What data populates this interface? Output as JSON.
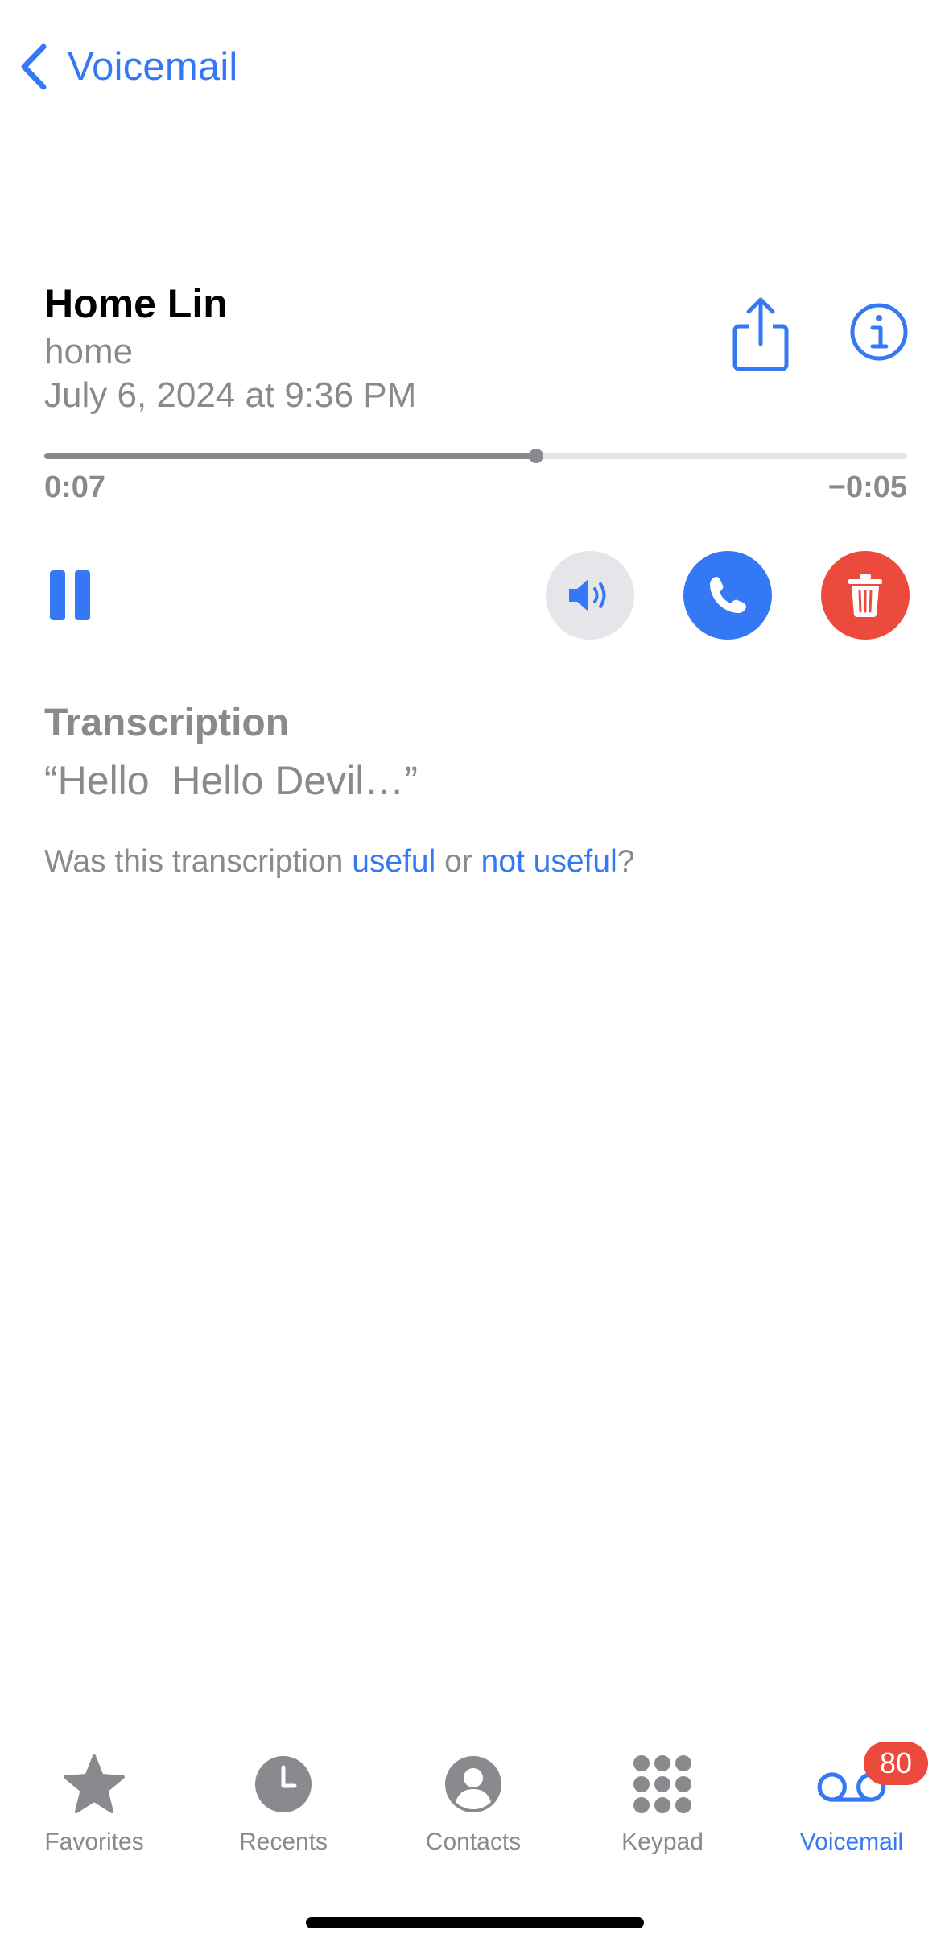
{
  "nav": {
    "back_label": "Voicemail"
  },
  "voicemail": {
    "caller_name": "Home Lin",
    "caller_label": "home",
    "date": "July 6, 2024 at 9:36 PM",
    "elapsed": "0:07",
    "remaining": "−0:05",
    "progress": 0.57
  },
  "transcription": {
    "title": "Transcription",
    "text": "“Hello  Hello Devil…”",
    "feedback_prefix": "Was this transcription ",
    "useful_label": "useful",
    "feedback_middle": " or ",
    "not_useful_label": "not useful",
    "feedback_suffix": "?"
  },
  "icons": {
    "back": "chevron-left-icon",
    "share": "share-icon",
    "info": "info-icon",
    "pause": "pause-icon",
    "speaker": "speaker-icon",
    "call": "phone-icon",
    "delete": "trash-icon"
  },
  "tabs": [
    {
      "label": "Favorites",
      "icon": "star-icon",
      "active": false
    },
    {
      "label": "Recents",
      "icon": "clock-icon",
      "active": false
    },
    {
      "label": "Contacts",
      "icon": "person-icon",
      "active": false
    },
    {
      "label": "Keypad",
      "icon": "keypad-icon",
      "active": false
    },
    {
      "label": "Voicemail",
      "icon": "voicemail-icon",
      "active": true,
      "badge": "80"
    }
  ],
  "colors": {
    "accent": "#3478f6",
    "destructive": "#eb4a3d",
    "secondary_text": "#8a8a8e",
    "control_bg": "#e5e5ea"
  }
}
